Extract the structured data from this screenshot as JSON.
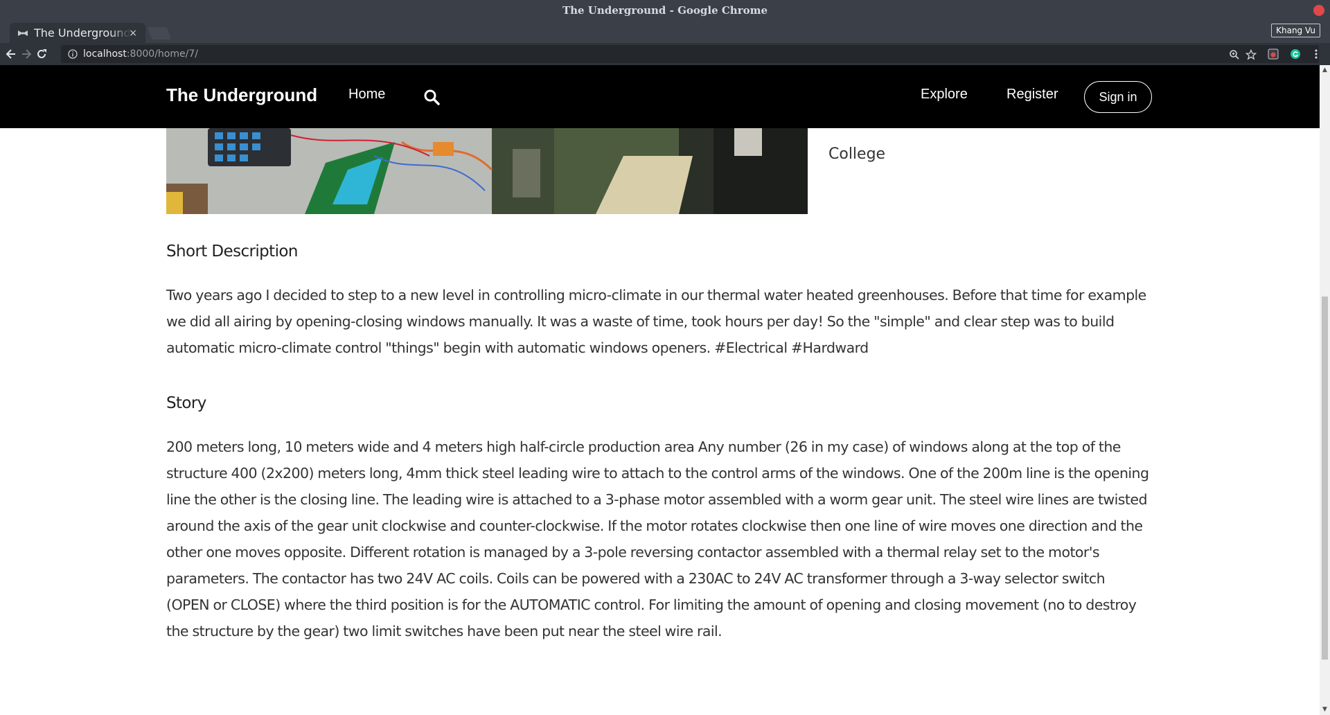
{
  "window": {
    "title": "The Underground - Google Chrome"
  },
  "tab": {
    "title": "The Underground",
    "close_glyph": "×"
  },
  "profile": {
    "name": "Khang Vu"
  },
  "address": {
    "host": "localhost",
    "path": ":8000/home/7/"
  },
  "icons": {
    "back": "arrow-left-icon",
    "forward": "arrow-right-icon",
    "reload": "reload-icon",
    "info": "info-icon",
    "zoom": "zoom-icon",
    "bookmark": "star-icon",
    "ext1": "extension-icon",
    "ext2": "grammarly-icon",
    "menu": "kebab-menu-icon",
    "search": "search-icon"
  },
  "site": {
    "brand": "The Underground",
    "nav": {
      "home": "Home",
      "explore": "Explore",
      "register": "Register",
      "sign_in": "Sign in"
    }
  },
  "project": {
    "meta_label": "College"
  },
  "sections": {
    "short_description": {
      "heading": "Short Description",
      "body": "Two years ago I decided to step to a new level in controlling micro-climate in our thermal water heated greenhouses. Before that time for example we did all airing by opening-closing windows manually. It was a waste of time, took hours per day! So the \"simple\" and clear step was to build automatic micro-climate control \"things\" begin with automatic windows openers. #Electrical #Hardward"
    },
    "story": {
      "heading": "Story",
      "body": "200 meters long, 10 meters wide and 4 meters high half-circle production area Any number (26 in my case) of windows along at the top of the structure 400 (2x200) meters long, 4mm thick steel leading wire to attach to the control arms of the windows. One of the 200m line is the opening line the other is the closing line. The leading wire is attached to a 3-phase motor assembled with a worm gear unit. The steel wire lines are twisted around the axis of the gear unit clockwise and counter-clockwise. If the motor rotates clockwise then one line of wire moves one direction and the other one moves opposite. Different rotation is managed by a 3-pole reversing contactor assembled with a thermal relay set to the motor's parameters. The contactor has two 24V AC coils. Coils can be powered with a 230AC to 24V AC transformer through a 3-way selector switch (OPEN or CLOSE) where the third position is for the AUTOMATIC control. For limiting the amount of opening and closing movement (no to destroy the structure by the gear) two limit switches have been put near the steel wire rail."
    }
  },
  "scrollbar": {
    "up_glyph": "▲",
    "down_glyph": "▼"
  }
}
